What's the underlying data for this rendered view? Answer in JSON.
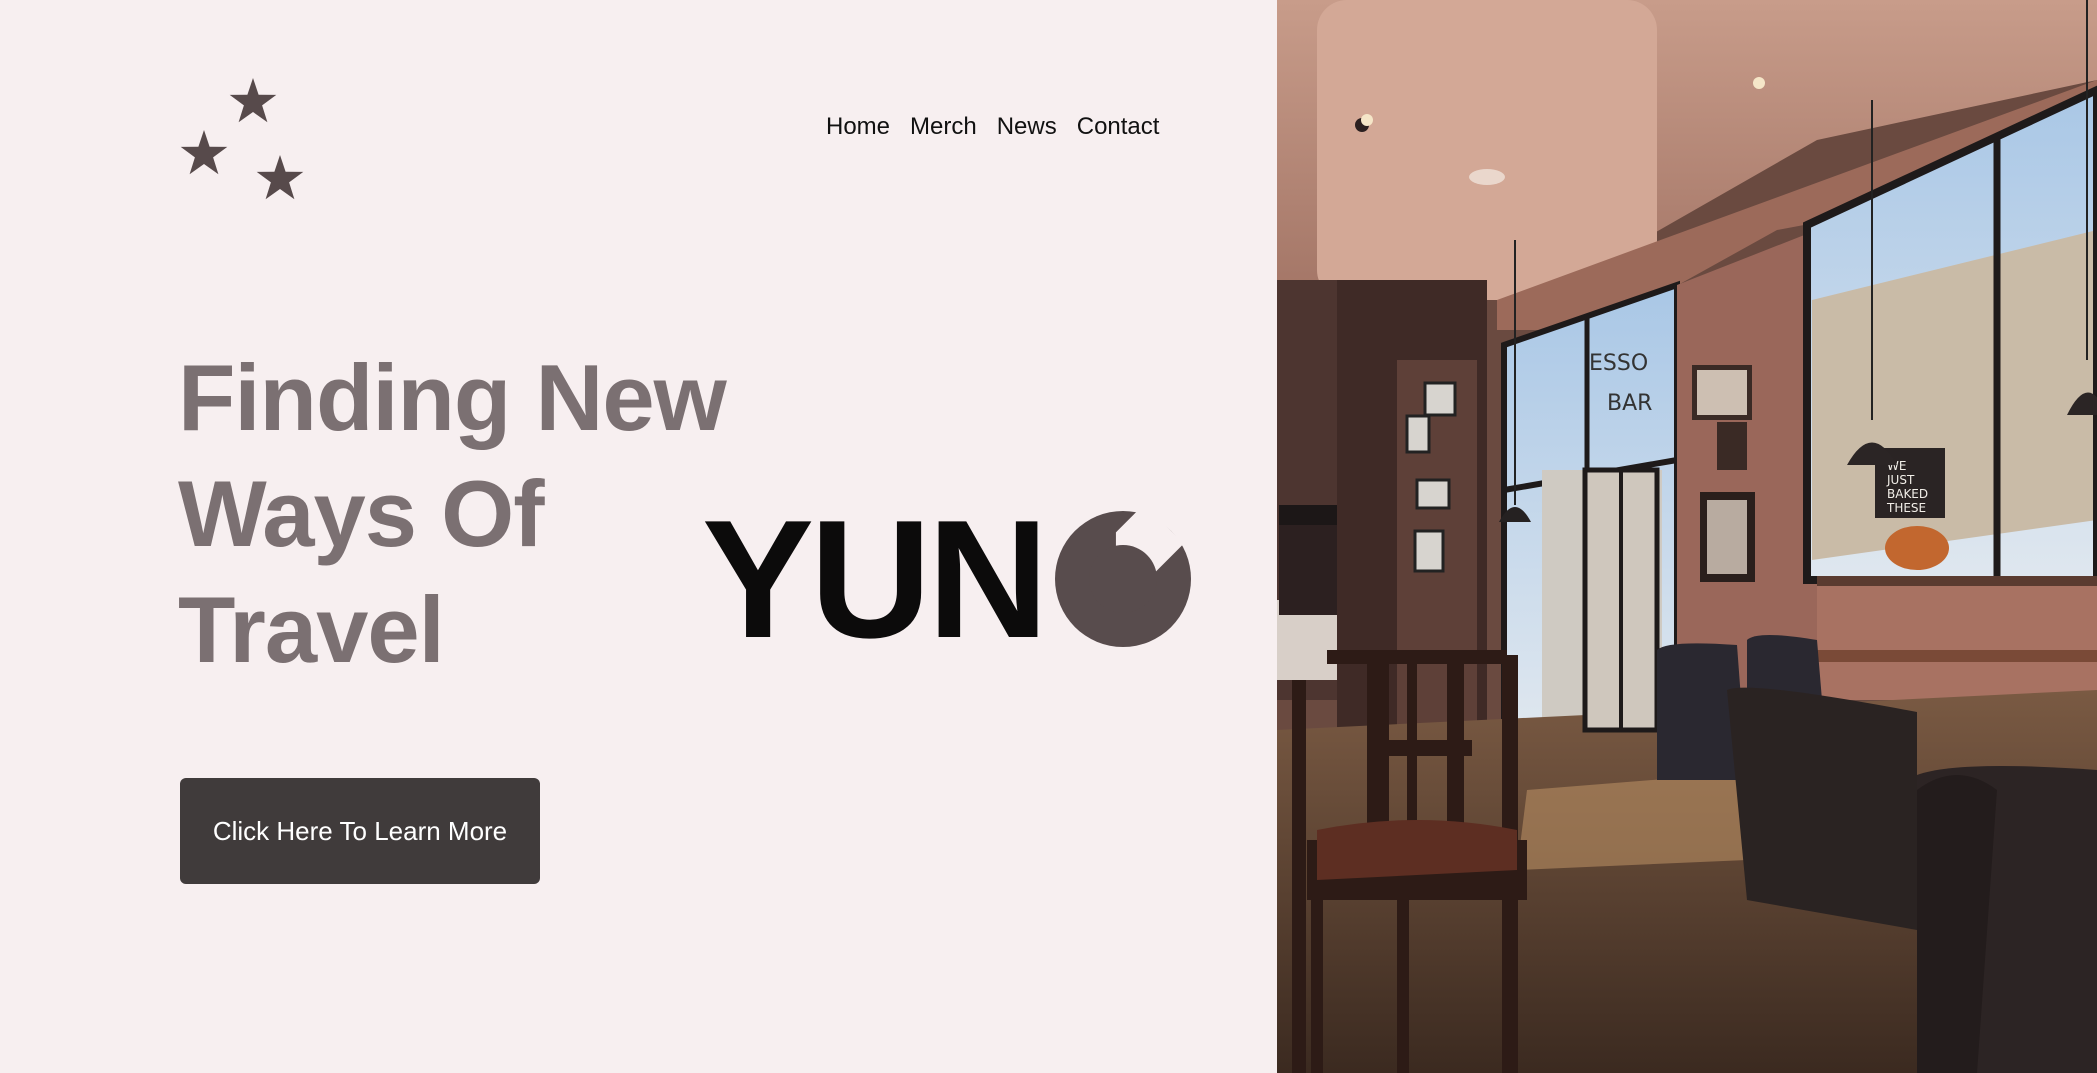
{
  "nav": {
    "items": [
      {
        "label": "Home"
      },
      {
        "label": "Merch"
      },
      {
        "label": "News"
      },
      {
        "label": "Contact"
      }
    ]
  },
  "hero": {
    "headline_lines": [
      "Finding New",
      "Ways Of",
      "Travel"
    ],
    "cta_label": "Click Here To Learn More"
  },
  "brand": {
    "wordmark": "YUNG",
    "wordmark_text": "YUN"
  },
  "photo": {
    "window_sign_lines": [
      "WE",
      "JUST",
      "BAKED",
      "THESE"
    ],
    "glass_lettering": [
      "ESSO",
      "BAR"
    ]
  },
  "colors": {
    "background": "#f7eff0",
    "star": "#574a4b",
    "headline": "#7b7072",
    "button": "#403b3b",
    "wordmark_dark": "#0c0b0b",
    "wordmark_accent": "#584c4d"
  }
}
